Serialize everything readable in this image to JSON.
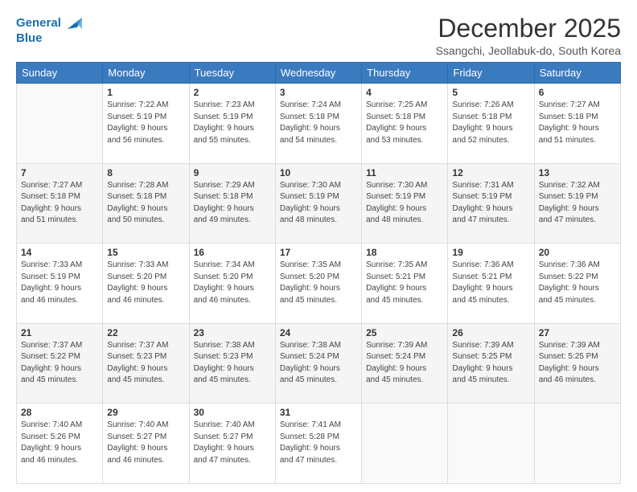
{
  "logo": {
    "line1": "General",
    "line2": "Blue"
  },
  "title": "December 2025",
  "location": "Ssangchi, Jeollabuk-do, South Korea",
  "days_of_week": [
    "Sunday",
    "Monday",
    "Tuesday",
    "Wednesday",
    "Thursday",
    "Friday",
    "Saturday"
  ],
  "weeks": [
    [
      {
        "day": "",
        "info": ""
      },
      {
        "day": "1",
        "info": "Sunrise: 7:22 AM\nSunset: 5:19 PM\nDaylight: 9 hours\nand 56 minutes."
      },
      {
        "day": "2",
        "info": "Sunrise: 7:23 AM\nSunset: 5:19 PM\nDaylight: 9 hours\nand 55 minutes."
      },
      {
        "day": "3",
        "info": "Sunrise: 7:24 AM\nSunset: 5:18 PM\nDaylight: 9 hours\nand 54 minutes."
      },
      {
        "day": "4",
        "info": "Sunrise: 7:25 AM\nSunset: 5:18 PM\nDaylight: 9 hours\nand 53 minutes."
      },
      {
        "day": "5",
        "info": "Sunrise: 7:26 AM\nSunset: 5:18 PM\nDaylight: 9 hours\nand 52 minutes."
      },
      {
        "day": "6",
        "info": "Sunrise: 7:27 AM\nSunset: 5:18 PM\nDaylight: 9 hours\nand 51 minutes."
      }
    ],
    [
      {
        "day": "7",
        "info": "Sunrise: 7:27 AM\nSunset: 5:18 PM\nDaylight: 9 hours\nand 51 minutes."
      },
      {
        "day": "8",
        "info": "Sunrise: 7:28 AM\nSunset: 5:18 PM\nDaylight: 9 hours\nand 50 minutes."
      },
      {
        "day": "9",
        "info": "Sunrise: 7:29 AM\nSunset: 5:18 PM\nDaylight: 9 hours\nand 49 minutes."
      },
      {
        "day": "10",
        "info": "Sunrise: 7:30 AM\nSunset: 5:19 PM\nDaylight: 9 hours\nand 48 minutes."
      },
      {
        "day": "11",
        "info": "Sunrise: 7:30 AM\nSunset: 5:19 PM\nDaylight: 9 hours\nand 48 minutes."
      },
      {
        "day": "12",
        "info": "Sunrise: 7:31 AM\nSunset: 5:19 PM\nDaylight: 9 hours\nand 47 minutes."
      },
      {
        "day": "13",
        "info": "Sunrise: 7:32 AM\nSunset: 5:19 PM\nDaylight: 9 hours\nand 47 minutes."
      }
    ],
    [
      {
        "day": "14",
        "info": "Sunrise: 7:33 AM\nSunset: 5:19 PM\nDaylight: 9 hours\nand 46 minutes."
      },
      {
        "day": "15",
        "info": "Sunrise: 7:33 AM\nSunset: 5:20 PM\nDaylight: 9 hours\nand 46 minutes."
      },
      {
        "day": "16",
        "info": "Sunrise: 7:34 AM\nSunset: 5:20 PM\nDaylight: 9 hours\nand 46 minutes."
      },
      {
        "day": "17",
        "info": "Sunrise: 7:35 AM\nSunset: 5:20 PM\nDaylight: 9 hours\nand 45 minutes."
      },
      {
        "day": "18",
        "info": "Sunrise: 7:35 AM\nSunset: 5:21 PM\nDaylight: 9 hours\nand 45 minutes."
      },
      {
        "day": "19",
        "info": "Sunrise: 7:36 AM\nSunset: 5:21 PM\nDaylight: 9 hours\nand 45 minutes."
      },
      {
        "day": "20",
        "info": "Sunrise: 7:36 AM\nSunset: 5:22 PM\nDaylight: 9 hours\nand 45 minutes."
      }
    ],
    [
      {
        "day": "21",
        "info": "Sunrise: 7:37 AM\nSunset: 5:22 PM\nDaylight: 9 hours\nand 45 minutes."
      },
      {
        "day": "22",
        "info": "Sunrise: 7:37 AM\nSunset: 5:23 PM\nDaylight: 9 hours\nand 45 minutes."
      },
      {
        "day": "23",
        "info": "Sunrise: 7:38 AM\nSunset: 5:23 PM\nDaylight: 9 hours\nand 45 minutes."
      },
      {
        "day": "24",
        "info": "Sunrise: 7:38 AM\nSunset: 5:24 PM\nDaylight: 9 hours\nand 45 minutes."
      },
      {
        "day": "25",
        "info": "Sunrise: 7:39 AM\nSunset: 5:24 PM\nDaylight: 9 hours\nand 45 minutes."
      },
      {
        "day": "26",
        "info": "Sunrise: 7:39 AM\nSunset: 5:25 PM\nDaylight: 9 hours\nand 45 minutes."
      },
      {
        "day": "27",
        "info": "Sunrise: 7:39 AM\nSunset: 5:25 PM\nDaylight: 9 hours\nand 46 minutes."
      }
    ],
    [
      {
        "day": "28",
        "info": "Sunrise: 7:40 AM\nSunset: 5:26 PM\nDaylight: 9 hours\nand 46 minutes."
      },
      {
        "day": "29",
        "info": "Sunrise: 7:40 AM\nSunset: 5:27 PM\nDaylight: 9 hours\nand 46 minutes."
      },
      {
        "day": "30",
        "info": "Sunrise: 7:40 AM\nSunset: 5:27 PM\nDaylight: 9 hours\nand 47 minutes."
      },
      {
        "day": "31",
        "info": "Sunrise: 7:41 AM\nSunset: 5:28 PM\nDaylight: 9 hours\nand 47 minutes."
      },
      {
        "day": "",
        "info": ""
      },
      {
        "day": "",
        "info": ""
      },
      {
        "day": "",
        "info": ""
      }
    ]
  ]
}
